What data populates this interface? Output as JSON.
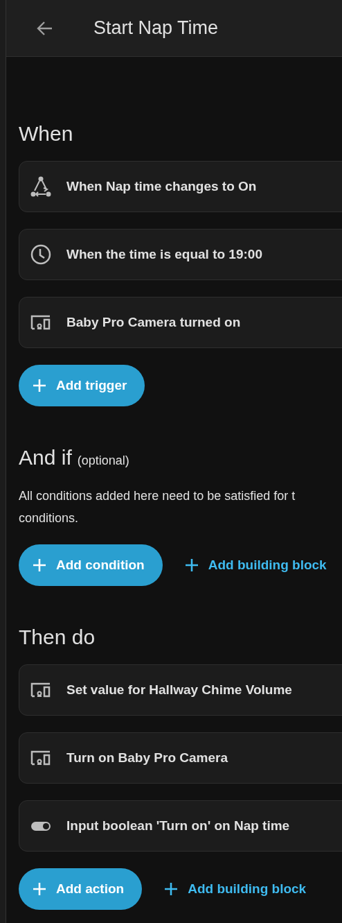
{
  "header": {
    "title": "Start Nap Time"
  },
  "sections": [
    {
      "heading": "When",
      "items": [
        {
          "kind": "trigger",
          "label": "When Nap time changes to On"
        },
        {
          "kind": "clock",
          "label": "When the time is equal to 19:00"
        },
        {
          "kind": "device",
          "label": "Baby Pro Camera turned on"
        }
      ],
      "buttons": [
        {
          "kind": "filled",
          "label": "Add trigger"
        }
      ]
    },
    {
      "heading": "And if",
      "optional": "(optional)",
      "description": "All conditions added here need to be satisfied for t\nconditions.",
      "buttons": [
        {
          "kind": "filled",
          "label": "Add condition"
        },
        {
          "kind": "text",
          "label": "Add building block"
        }
      ]
    },
    {
      "heading": "Then do",
      "items": [
        {
          "kind": "device",
          "label": "Set value for Hallway Chime Volume"
        },
        {
          "kind": "device",
          "label": "Turn on Baby Pro Camera"
        },
        {
          "kind": "toggle",
          "label": "Input boolean 'Turn on' on Nap time"
        }
      ],
      "buttons": [
        {
          "kind": "filled",
          "label": "Add action"
        },
        {
          "kind": "text",
          "label": "Add building block"
        }
      ]
    }
  ]
}
